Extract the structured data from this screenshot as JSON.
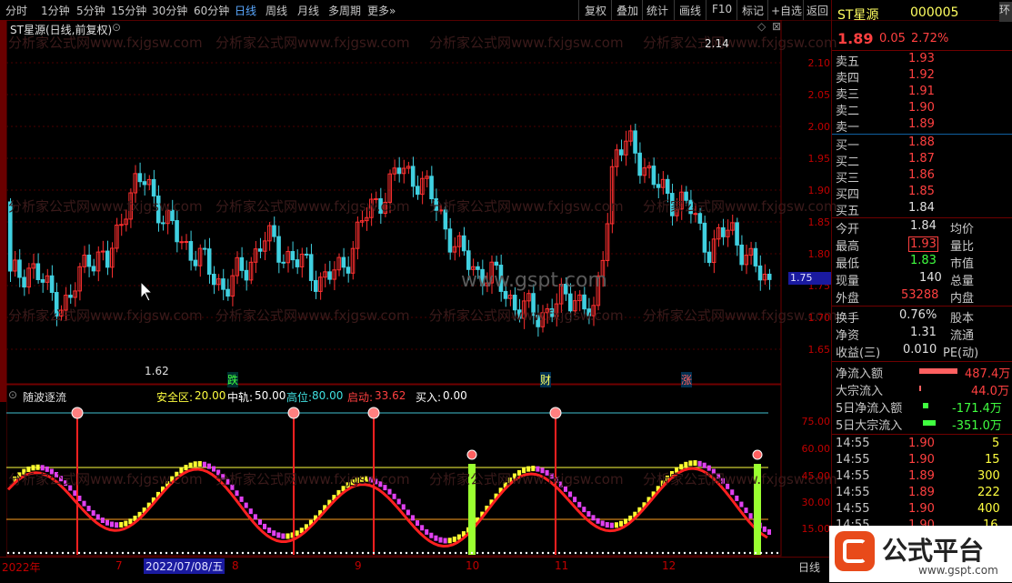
{
  "toolbar": {
    "periods": [
      "分时",
      "1分钟",
      "5分钟",
      "15分钟",
      "30分钟",
      "60分钟",
      "日线",
      "周线",
      "月线",
      "多周期",
      "更多»"
    ],
    "active_period": "日线",
    "buttons": [
      "复权",
      "叠加",
      "统计",
      "画线",
      "F10",
      "标记",
      "+自选",
      "返回"
    ]
  },
  "main_chart": {
    "title": "ST星源(日线,前复权)",
    "watermark": "分析家公式网www.fxjgsw.com",
    "center_watermark": "www.gspt.com",
    "high_label": "2.14",
    "low_label": "1.62",
    "event_labels": [
      "跌",
      "财",
      "涨"
    ],
    "price_axis": [
      "2.10",
      "2.05",
      "2.00",
      "1.95",
      "1.90",
      "1.85",
      "1.80",
      "1.75",
      "1.70",
      "1.65"
    ],
    "current_price_tag": "1.75"
  },
  "indicator": {
    "name": "随波逐流",
    "params": [
      {
        "label": "安全区:",
        "value": "20.00",
        "color": "#ffff40"
      },
      {
        "label": "中轨:",
        "value": "50.00",
        "color": "#ffffff"
      },
      {
        "label": "高位:",
        "value": "80.00",
        "color": "#40e0e0"
      },
      {
        "label": "启动:",
        "value": "33.62",
        "color": "#ff4040"
      },
      {
        "label": "买入:",
        "value": "0.00",
        "color": "#ffffff"
      }
    ],
    "axis": [
      "75.00",
      "60.00",
      "45.00",
      "30.00",
      "15.00"
    ]
  },
  "date_axis": {
    "labels": [
      "2022年",
      "7",
      "8",
      "9",
      "10",
      "11",
      "12"
    ],
    "cursor_date": "2022/07/08/五",
    "period_tag": "日线"
  },
  "sidebar": {
    "tab_right": "环",
    "stock_name": "ST星源",
    "stock_code": "000005",
    "price": "1.89",
    "change": "0.05",
    "change_pct": "2.72%",
    "asks": [
      {
        "label": "卖五",
        "price": "1.93"
      },
      {
        "label": "卖四",
        "price": "1.92"
      },
      {
        "label": "卖三",
        "price": "1.91"
      },
      {
        "label": "卖二",
        "price": "1.90"
      },
      {
        "label": "卖一",
        "price": "1.89"
      }
    ],
    "bids": [
      {
        "label": "买一",
        "price": "1.88"
      },
      {
        "label": "买二",
        "price": "1.87"
      },
      {
        "label": "买三",
        "price": "1.86"
      },
      {
        "label": "买四",
        "price": "1.85"
      },
      {
        "label": "买五",
        "price": "1.84"
      }
    ],
    "stats": [
      {
        "label": "今开",
        "value": "1.84",
        "label2": "均价"
      },
      {
        "label": "最高",
        "value": "1.93",
        "label2": "量比"
      },
      {
        "label": "最低",
        "value": "1.83",
        "label2": "市值"
      },
      {
        "label": "现量",
        "value": "140",
        "label2": "总量"
      },
      {
        "label": "外盘",
        "value": "53288",
        "label2": "内盘"
      }
    ],
    "stats2": [
      {
        "label": "换手",
        "value": "0.76%",
        "label2": "股本"
      },
      {
        "label": "净资",
        "value": "1.31",
        "label2": "流通"
      },
      {
        "label": "收益(三)",
        "value": "0.010",
        "label2": "PE(动)"
      }
    ],
    "flows": [
      {
        "label": "净流入额",
        "value": "487.4万",
        "bar": "#ff6060"
      },
      {
        "label": "大宗流入",
        "value": "44.0万",
        "bar": "#ff6060"
      },
      {
        "label": "5日净流入额",
        "value": "-171.4万",
        "bar": "#40ff40"
      },
      {
        "label": "5日大宗流入",
        "value": "-351.0万",
        "bar": "#40ff40"
      }
    ],
    "ticks": [
      {
        "time": "14:55",
        "price": "1.90",
        "vol": "5"
      },
      {
        "time": "14:55",
        "price": "1.90",
        "vol": "15"
      },
      {
        "time": "14:55",
        "price": "1.89",
        "vol": "300"
      },
      {
        "time": "14:55",
        "price": "1.89",
        "vol": "222"
      },
      {
        "time": "14:55",
        "price": "1.90",
        "vol": "400"
      },
      {
        "time": "14:55",
        "price": "1.90",
        "vol": "16"
      }
    ]
  },
  "logo": {
    "text": "公式平台",
    "url": "www.gspt.com"
  }
}
